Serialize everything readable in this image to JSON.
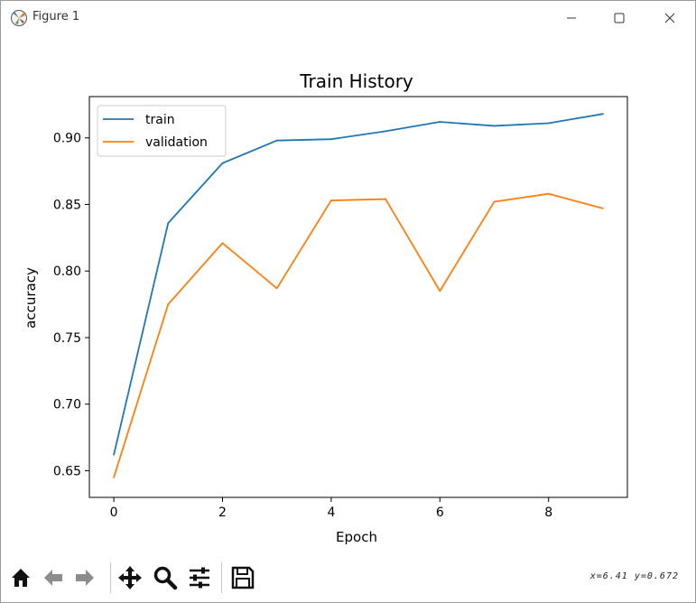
{
  "window": {
    "title": "Figure 1",
    "icon": "matplotlib-figure-icon",
    "controls": [
      "minimize-icon",
      "maximize-icon",
      "close-icon"
    ]
  },
  "toolbar": {
    "buttons": [
      {
        "name": "home-button",
        "icon": "home-icon"
      },
      {
        "name": "back-button",
        "icon": "arrow-left-icon"
      },
      {
        "name": "forward-button",
        "icon": "arrow-right-icon"
      },
      {
        "name": "pan-button",
        "icon": "move-icon"
      },
      {
        "name": "zoom-button",
        "icon": "magnifier-icon"
      },
      {
        "name": "configure-subplots-button",
        "icon": "sliders-icon"
      },
      {
        "name": "save-button",
        "icon": "floppy-disk-icon"
      }
    ],
    "coordinate_readout": "x=6.41  y=0.672"
  },
  "chart_data": {
    "type": "line",
    "title": "Train History",
    "xlabel": "Epoch",
    "ylabel": "accuracy",
    "x": [
      0,
      1,
      2,
      3,
      4,
      5,
      6,
      7,
      8,
      9
    ],
    "xlim": [
      -0.45,
      9.45
    ],
    "ylim": [
      0.63,
      0.931
    ],
    "x_ticks": [
      0,
      2,
      4,
      6,
      8
    ],
    "x_tick_labels": [
      "0",
      "2",
      "4",
      "6",
      "8"
    ],
    "y_ticks": [
      0.65,
      0.7,
      0.75,
      0.8,
      0.85,
      0.9
    ],
    "y_tick_labels": [
      "0.65",
      "0.70",
      "0.75",
      "0.80",
      "0.85",
      "0.90"
    ],
    "grid": false,
    "legend_position": "top-left",
    "series": [
      {
        "name": "train",
        "color": "#1f77b4",
        "values": [
          0.662,
          0.836,
          0.881,
          0.898,
          0.899,
          0.905,
          0.912,
          0.909,
          0.911,
          0.918
        ]
      },
      {
        "name": "validation",
        "color": "#ff7f0e",
        "values": [
          0.645,
          0.775,
          0.821,
          0.787,
          0.853,
          0.854,
          0.785,
          0.852,
          0.858,
          0.847
        ]
      }
    ]
  }
}
